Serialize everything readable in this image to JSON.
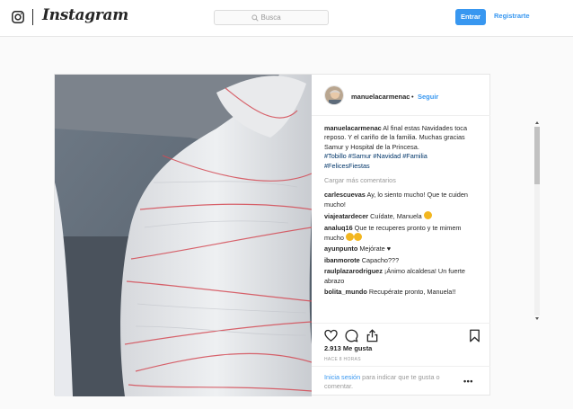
{
  "brand": {
    "wordmark": "Instagram"
  },
  "search": {
    "placeholder": "Busca"
  },
  "nav": {
    "login_label": "Entrar",
    "register_label": "Registrarte"
  },
  "post": {
    "username": "manuelacarmenac",
    "dot": "•",
    "follow_label": "Seguir",
    "caption": {
      "user": "manuelacarmenac",
      "text": " Al final estas Navidades toca reposo. Y el cariño de la familia. Muchas gracias Samur y Hospital de la Princesa.",
      "tags": [
        "#Tobillo",
        "#Samur",
        "#Navidad",
        "#Familia",
        "#FelicesFiestas"
      ]
    },
    "load_more": "Cargar más comentarios",
    "comments": [
      {
        "user": "carlescuevas",
        "text": " Ay, lo siento mucho! Que te cuiden mucho!"
      },
      {
        "user": "viajeatardecer",
        "text": " Cuídate, Manuela "
      },
      {
        "user": "analuq16",
        "text": " Que te recuperes pronto y te mimem mucho "
      },
      {
        "user": "ayunpunto",
        "text": " Mejórate ♥"
      },
      {
        "user": "ibanmorote",
        "text": " Capacho???"
      },
      {
        "user": "raulplazarodriguez",
        "text": " ¡Ánimo alcaldesa! Un fuerte abrazo"
      },
      {
        "user": "bolita_mundo",
        "text": " Recupérate pronto, Manuela!!"
      }
    ],
    "likes": "2.913 Me gusta",
    "time": "HACE 8 HORAS",
    "login_link": "Inicia sesión",
    "login_text": " para indicar que te gusta o comentar.",
    "more_options": "•••"
  },
  "colors": {
    "accent": "#3897f0",
    "border": "#e6e6e6",
    "text": "#262626",
    "muted": "#999999"
  }
}
